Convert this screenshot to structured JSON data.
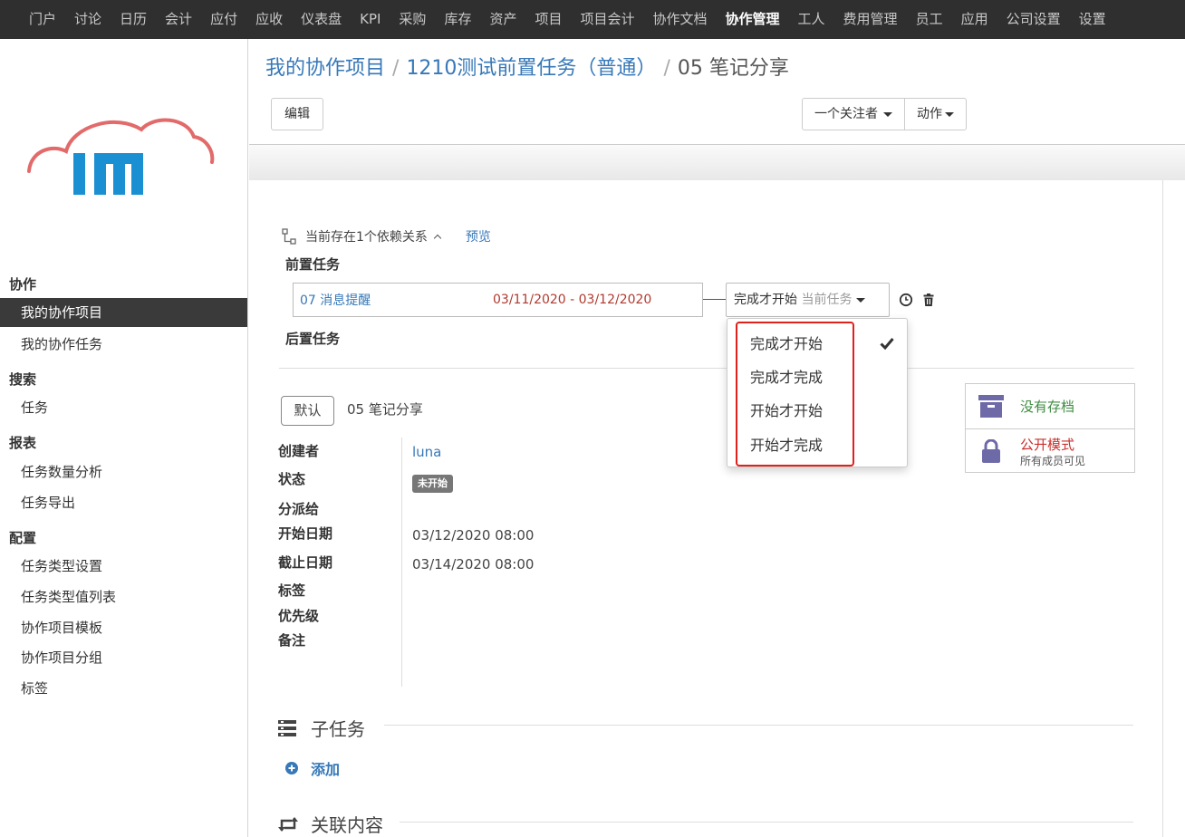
{
  "topnav": {
    "items": [
      "门户",
      "讨论",
      "日历",
      "会计",
      "应付",
      "应收",
      "仪表盘",
      "KPI",
      "采购",
      "库存",
      "资产",
      "项目",
      "项目会计",
      "协作文档",
      "协作管理",
      "工人",
      "费用管理",
      "员工",
      "应用",
      "公司设置",
      "设置"
    ],
    "active": "协作管理"
  },
  "sidebar": {
    "sections": [
      {
        "title": "协作",
        "items": [
          "我的协作项目",
          "我的协作任务"
        ]
      },
      {
        "title": "搜索",
        "items": [
          "任务"
        ]
      },
      {
        "title": "报表",
        "items": [
          "任务数量分析",
          "任务导出"
        ]
      },
      {
        "title": "配置",
        "items": [
          "任务类型设置",
          "任务类型值列表",
          "协作项目模板",
          "协作项目分组",
          "标签"
        ]
      }
    ],
    "active_item": "我的协作项目"
  },
  "breadcrumb": {
    "items": [
      "我的协作项目",
      "1210测试前置任务（普通）"
    ],
    "current": "05 笔记分享"
  },
  "toolbar": {
    "edit_label": "编辑",
    "followers_label": "一个关注者",
    "action_label": "动作"
  },
  "dependency": {
    "summary": "当前存在1个依赖关系",
    "preview_label": "预览",
    "pre_task_title": "前置任务",
    "post_task_title": "后置任务",
    "pre_task": {
      "name": "07 消息提醒",
      "dates": "03/11/2020 - 03/12/2020"
    },
    "relation_selected": "完成才开始",
    "relation_suffix": "当前任务",
    "relation_options": [
      "完成才开始",
      "完成才完成",
      "开始才开始",
      "开始才完成"
    ],
    "checked_option_index": 0
  },
  "task": {
    "stage": "默认",
    "name": "05 笔记分享",
    "fields": {
      "creator_label": "创建者",
      "creator": "luna",
      "status_label": "状态",
      "status": "未开始",
      "assignee_label": "分派给",
      "start_label": "开始日期",
      "start": "03/12/2020 08:00",
      "deadline_label": "截止日期",
      "deadline": "03/14/2020 08:00",
      "tags_label": "标签",
      "priority_label": "优先级",
      "notes_label": "备注"
    }
  },
  "status_card": {
    "archive_label": "没有存档",
    "visibility_label": "公开模式",
    "visibility_sub": "所有成员可见"
  },
  "subtasks": {
    "title": "子任务",
    "add_label": "添加"
  },
  "related": {
    "title": "关联内容"
  },
  "colors": {
    "nav_bg": "#2f2f2f",
    "link": "#3778b8",
    "date_red": "#b03a2e",
    "highlight_red": "#e0201a",
    "archive_green": "#3d8c40",
    "archive_icon": "#6e6aa8"
  }
}
